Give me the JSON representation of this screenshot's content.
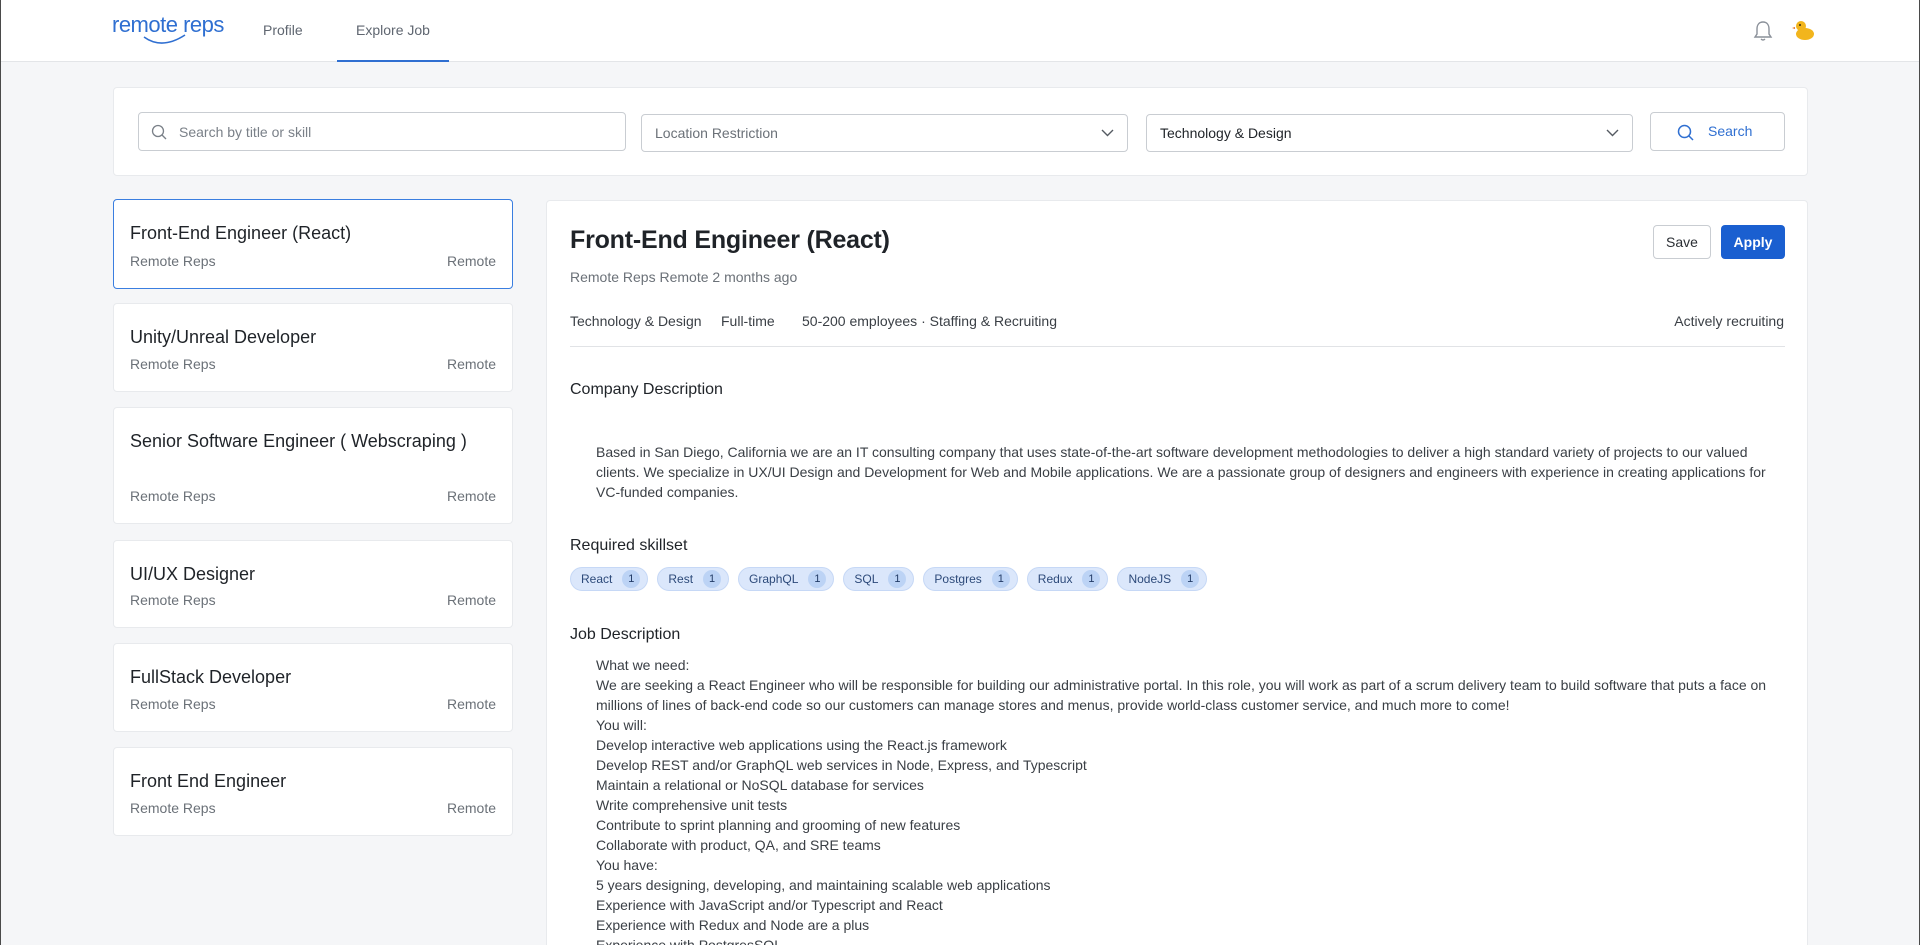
{
  "header": {
    "logo_text": "remote reps",
    "nav": [
      {
        "label": "Profile"
      },
      {
        "label": "Explore Job"
      }
    ]
  },
  "search": {
    "placeholder": "Search by title or skill",
    "location_placeholder": "Location Restriction",
    "category_value": "Technology & Design",
    "button_label": "Search"
  },
  "jobs": [
    {
      "title": "Front-End Engineer (React)",
      "company": "Remote Reps",
      "location": "Remote"
    },
    {
      "title": "Unity/Unreal Developer",
      "company": "Remote Reps",
      "location": "Remote"
    },
    {
      "title": "Senior Software Engineer ( Webscraping )",
      "company": "Remote Reps",
      "location": "Remote"
    },
    {
      "title": "UI/UX Designer",
      "company": "Remote Reps",
      "location": "Remote"
    },
    {
      "title": "FullStack Developer",
      "company": "Remote Reps",
      "location": "Remote"
    },
    {
      "title": "Front End Engineer",
      "company": "Remote Reps",
      "location": "Remote"
    }
  ],
  "detail": {
    "title": "Front-End Engineer (React)",
    "meta": "Remote Reps Remote 2 months ago",
    "save_label": "Save",
    "apply_label": "Apply",
    "category": "Technology & Design",
    "job_type": "Full-time",
    "company_size": "50-200 employees · Staffing & Recruiting",
    "status": "Actively recruiting",
    "company_heading": "Company Description",
    "company_description": "Based in San Diego, California we are an IT consulting company that uses state-of-the-art software development methodologies to deliver a high standard variety of projects to our valued clients. We specialize in UX/UI Design and Development for Web and Mobile applications. We are a passionate group of designers and engineers with experience in creating applications for VC-funded companies.",
    "skills_heading": "Required skillset",
    "skills": [
      {
        "name": "React",
        "count": "1"
      },
      {
        "name": "Rest",
        "count": "1"
      },
      {
        "name": "GraphQL",
        "count": "1"
      },
      {
        "name": "SQL",
        "count": "1"
      },
      {
        "name": "Postgres",
        "count": "1"
      },
      {
        "name": "Redux",
        "count": "1"
      },
      {
        "name": "NodeJS",
        "count": "1"
      }
    ],
    "job_heading": "Job Description",
    "job_lines": [
      "What we need:",
      "We are seeking a React Engineer who will be responsible for building our administrative portal. In this role, you will work as part of a scrum delivery team to build software that puts a face on millions of lines of back-end code so our customers can manage stores and menus, provide world-class customer service, and much more to come!",
      "You will:",
      "Develop interactive web applications using the React.js framework",
      "Develop REST and/or GraphQL web services in Node, Express, and Typescript",
      "Maintain a relational or NoSQL database for services",
      "Write comprehensive unit tests",
      "Contribute to sprint planning and grooming of new features",
      "Collaborate with product, QA, and SRE teams",
      "You have:",
      "5 years designing, developing, and maintaining scalable web applications",
      "Experience with JavaScript and/or Typescript and React",
      "Experience with Redux and Node are a plus",
      "Experience with PostgresSQL"
    ]
  },
  "colors": {
    "accent": "#2f6fd1",
    "apply_bg": "#1a5fd0",
    "chip_bg": "#dbe7fb"
  }
}
